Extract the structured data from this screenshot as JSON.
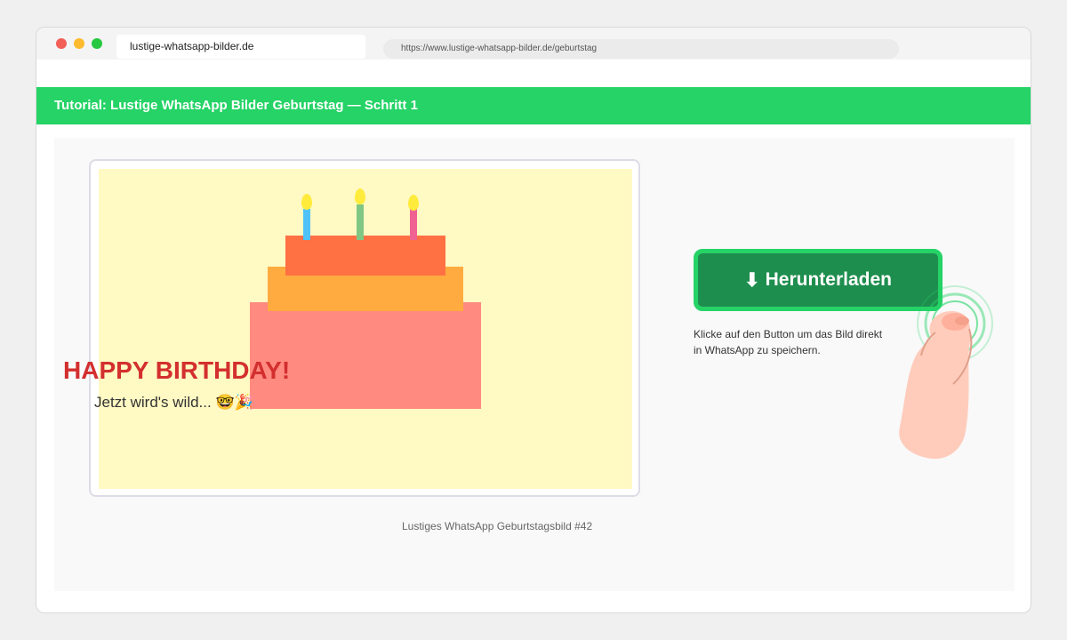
{
  "browser": {
    "tab_title": "lustige-whatsapp-bilder.de",
    "url": "https://www.lustige-whatsapp-bilder.de/geburtstag"
  },
  "banner": {
    "text": "Tutorial: Lustige WhatsApp Bilder Geburtstag — Schritt 1"
  },
  "image_card": {
    "title": "HAPPY BIRTHDAY!",
    "subtitle": "Jetzt wird's wild... 🤓🎉",
    "caption": "Lustiges WhatsApp Geburtstagsbild #42"
  },
  "download": {
    "arrow": "⬇",
    "label": "Herunterladen",
    "hint": "Klicke auf den Button um das Bild direkt in WhatsApp zu speichern."
  },
  "colors": {
    "brand_green": "#25d366",
    "button_green": "#1e8e4e",
    "title_red": "#d32f2f",
    "image_bg": "#fff9c4"
  },
  "icons": {
    "hand": "pointing-hand-icon",
    "cake": "birthday-cake-icon"
  }
}
